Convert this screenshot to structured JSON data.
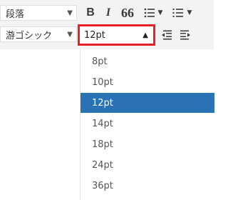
{
  "toolbar": {
    "paragraph_select": {
      "value": "段落",
      "arrow": "▼"
    },
    "font_select": {
      "value": "游ゴシック",
      "arrow": "▼"
    },
    "size_select": {
      "value": "12pt",
      "arrow": "▲"
    },
    "bold_label": "B",
    "italic_label": "I",
    "quote_label": "66",
    "dropdown_arrow": "▼"
  },
  "font_size_dropdown": {
    "options": [
      "8pt",
      "10pt",
      "12pt",
      "14pt",
      "18pt",
      "24pt",
      "36pt"
    ],
    "selected": "12pt"
  },
  "colors": {
    "highlight": "#e8202a",
    "selected_bg": "#2a72b5",
    "toolbar_bg": "#f3f3f3"
  },
  "icons": [
    "bullet-list-icon",
    "numbered-list-icon",
    "decrease-indent-icon",
    "increase-indent-icon"
  ]
}
